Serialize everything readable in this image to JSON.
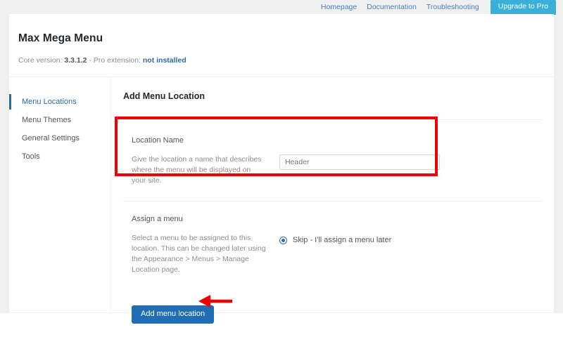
{
  "topnav": {
    "links": [
      {
        "label": "Homepage"
      },
      {
        "label": "Documentation"
      },
      {
        "label": "Troubleshooting"
      }
    ],
    "upgrade_button": "Upgrade to Pro"
  },
  "header": {
    "title": "Max Mega Menu",
    "version_prefix": "Core version:",
    "version_number": "3.3.1.2",
    "version_separator": "- Pro extension:",
    "pro_status": "not installed"
  },
  "sidebar": {
    "items": [
      {
        "label": "Menu Locations",
        "active": true
      },
      {
        "label": "Menu Themes",
        "active": false
      },
      {
        "label": "General Settings",
        "active": false
      },
      {
        "label": "Tools",
        "active": false
      }
    ]
  },
  "content": {
    "title": "Add Menu Location",
    "sections": [
      {
        "title": "Location Name",
        "description": "Give the location a name that describes where the menu will be displayed on your site.",
        "input_value": "Header",
        "input_placeholder": "Header"
      },
      {
        "title": "Assign a menu",
        "description": "Select a menu to be assigned to this location. This can be changed later using the Appearance > Menus > Manage Location page.",
        "radio_label": "Skip - I'll assign a menu later",
        "radio_selected": true
      }
    ],
    "submit_button": "Add menu location"
  },
  "colors": {
    "accent_blue": "#2d6ca2",
    "button_blue": "#1f6eb5",
    "upgrade_cyan": "#3ab0d8",
    "annotation_red": "#f00000",
    "page_background": "#f0f0f0"
  }
}
